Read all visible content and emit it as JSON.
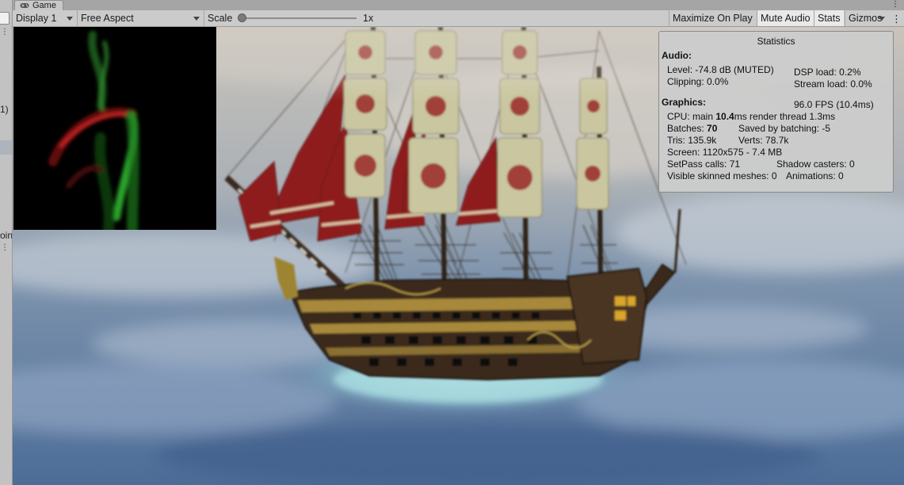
{
  "left_panel": {
    "fragment_1": "1)",
    "fragment_2": "oin"
  },
  "tab": {
    "title": "Game",
    "icon": "gamepad-icon"
  },
  "toolbar": {
    "display": "Display 1",
    "aspect": "Free Aspect",
    "scale_label": "Scale",
    "scale_value": "1x",
    "scale_fraction": 0.0,
    "maximize_on_play": "Maximize On Play",
    "mute_audio": "Mute Audio",
    "stats": "Stats",
    "gizmos": "Gizmos",
    "menu_icon": "kebab-menu-icon"
  },
  "stats": {
    "title": "Statistics",
    "audio_header": "Audio:",
    "level": "Level: -74.8 dB (MUTED)",
    "clipping": "Clipping: 0.0%",
    "dsp_load": "DSP load: 0.2%",
    "stream_load": "Stream load: 0.0%",
    "graphics_header": "Graphics:",
    "fps": "96.0 FPS (10.4ms)",
    "cpu_prefix": "CPU: main ",
    "cpu_main": "10.4",
    "cpu_suffix": "ms  render thread 1.3ms",
    "batches_prefix": "Batches: ",
    "batches": "70",
    "saved_by_batching": "Saved by batching: -5",
    "tris": "Tris: 135.9k",
    "verts": "Verts: 78.7k",
    "screen": "Screen: 1120x575 - 7.4 MB",
    "setpass": "SetPass calls: 71",
    "shadow_casters": "Shadow casters: 0",
    "skinned_meshes": "Visible skinned meshes: 0",
    "animations": "Animations: 0"
  },
  "colors": {
    "toolbar_bg": "#cbcbcb",
    "active_button": "#e9e9e9",
    "sail_red": "#8e1f1f",
    "sail_cream": "#c9c6a0",
    "hull": "#3a2a1c",
    "sea": "#5d7fa6"
  }
}
